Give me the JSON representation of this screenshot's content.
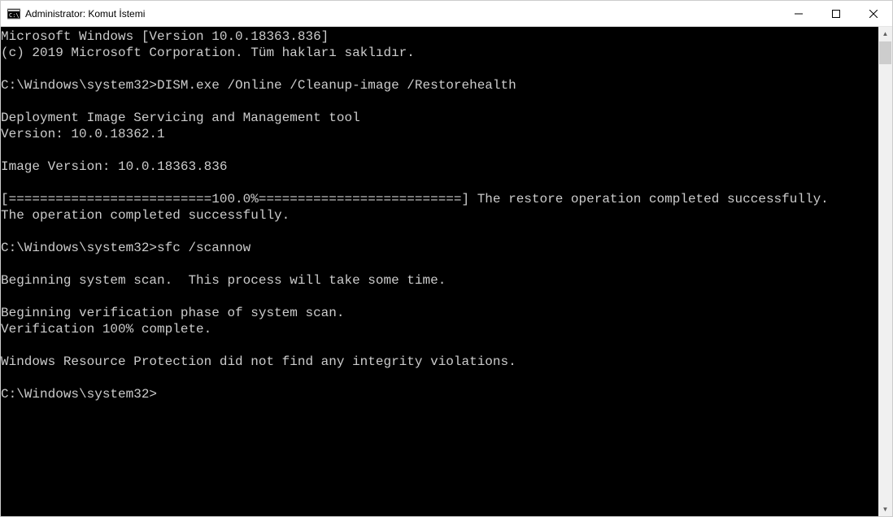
{
  "window": {
    "title": "Administrator: Komut İstemi"
  },
  "console": {
    "lines": [
      "Microsoft Windows [Version 10.0.18363.836]",
      "(c) 2019 Microsoft Corporation. Tüm hakları saklıdır.",
      "",
      "C:\\Windows\\system32>DISM.exe /Online /Cleanup-image /Restorehealth",
      "",
      "Deployment Image Servicing and Management tool",
      "Version: 10.0.18362.1",
      "",
      "Image Version: 10.0.18363.836",
      "",
      "[==========================100.0%==========================] The restore operation completed successfully.",
      "The operation completed successfully.",
      "",
      "C:\\Windows\\system32>sfc /scannow",
      "",
      "Beginning system scan.  This process will take some time.",
      "",
      "Beginning verification phase of system scan.",
      "Verification 100% complete.",
      "",
      "Windows Resource Protection did not find any integrity violations.",
      "",
      "C:\\Windows\\system32>"
    ]
  }
}
